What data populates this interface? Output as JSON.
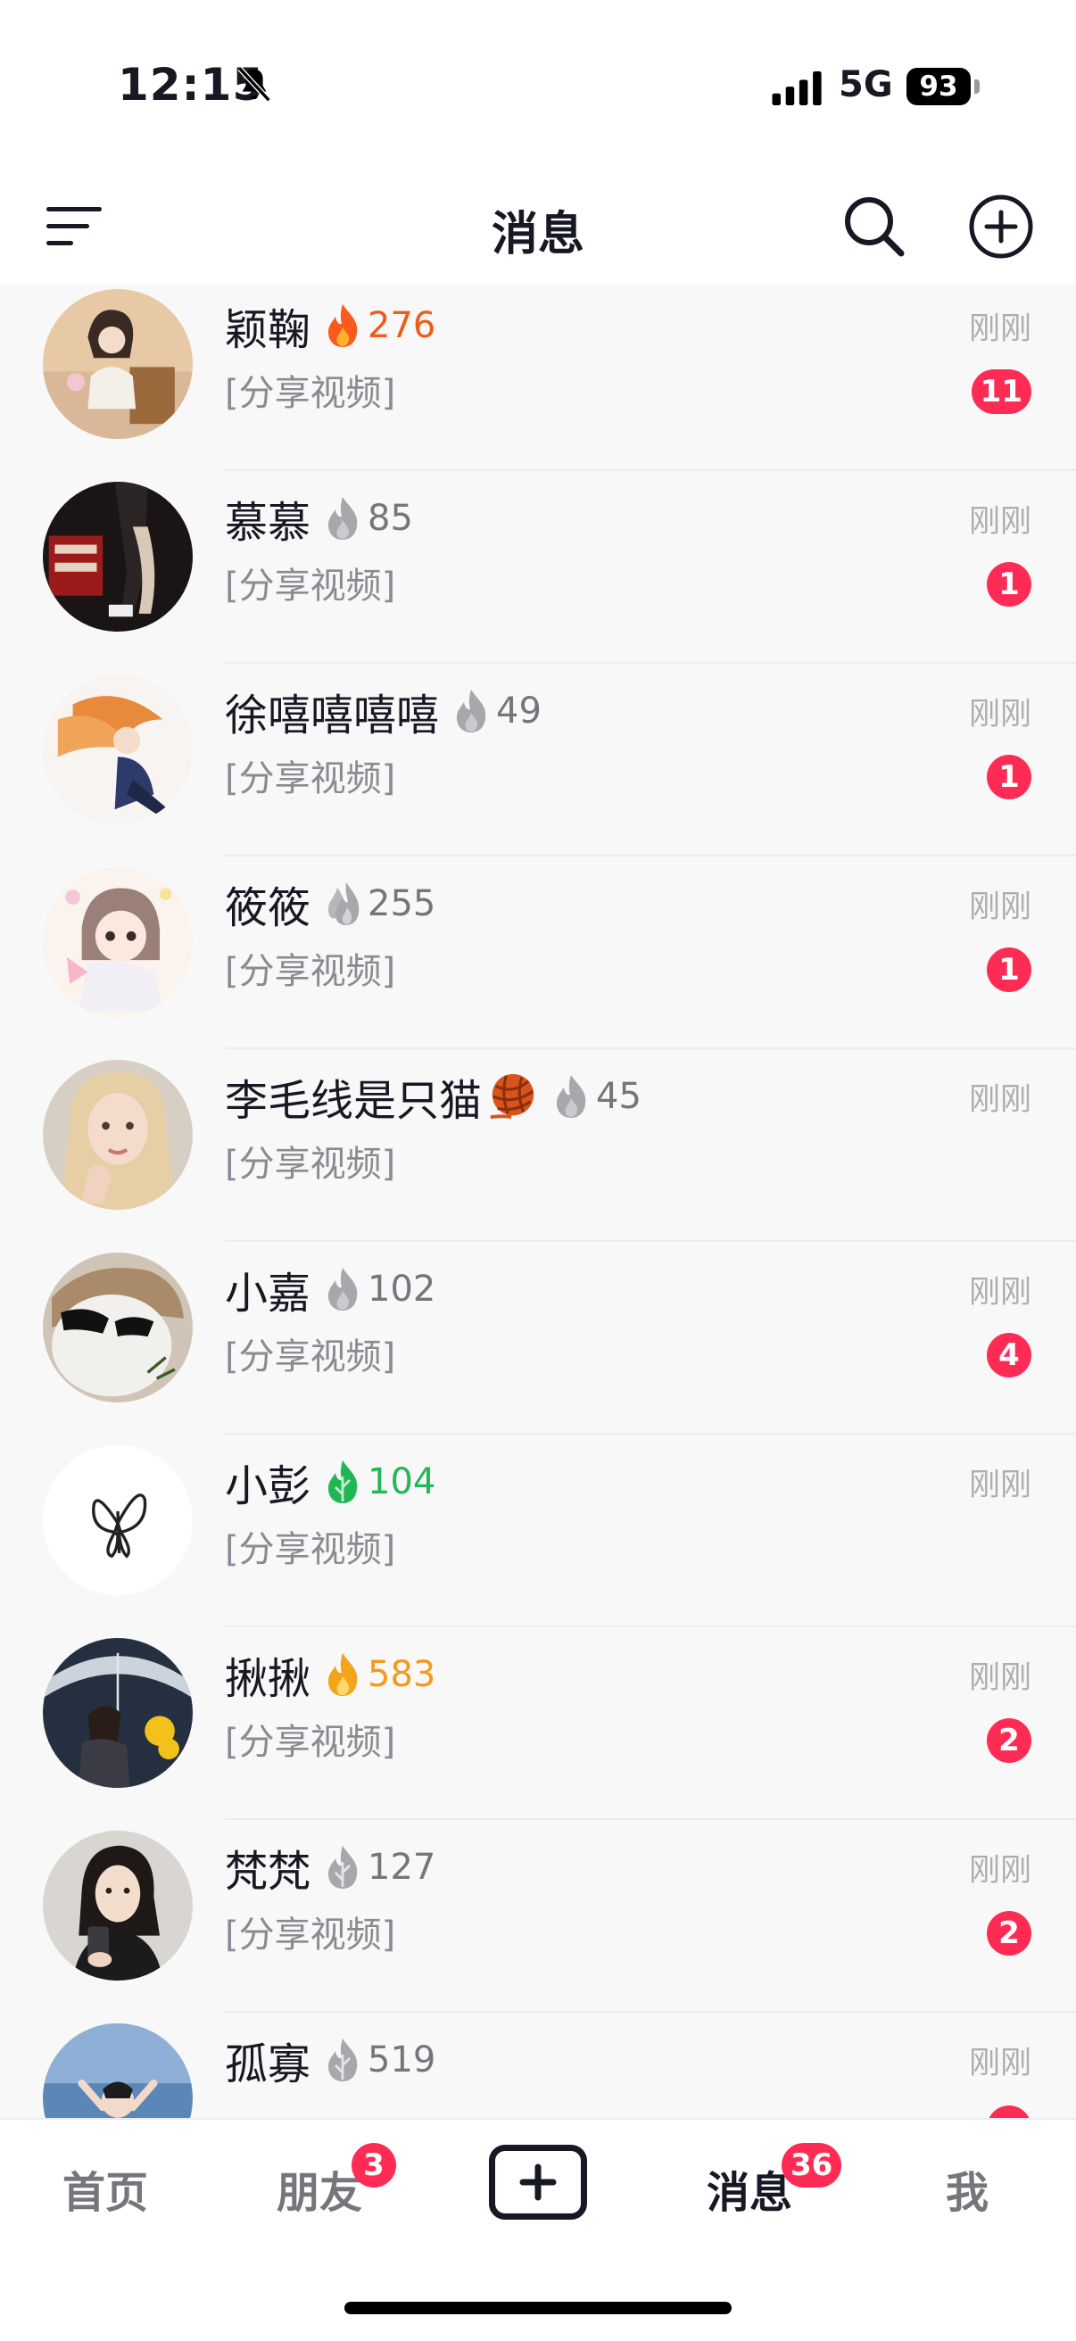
{
  "status_bar": {
    "time": "12:15",
    "network": "5G",
    "battery": "93"
  },
  "header": {
    "title": "消息"
  },
  "chats": [
    {
      "name": "颖鞠",
      "streak": "276",
      "streak_color": "#f05a1a",
      "flame": "orange-red",
      "preview": "[分享视频]",
      "time": "刚刚",
      "unread": "11"
    },
    {
      "name": "慕慕",
      "streak": "85",
      "streak_color": "#75767b",
      "flame": "grey",
      "preview": "[分享视频]",
      "time": "刚刚",
      "unread": "1"
    },
    {
      "name": "徐嘻嘻嘻嘻",
      "streak": "49",
      "streak_color": "#75767b",
      "flame": "grey",
      "preview": "[分享视频]",
      "time": "刚刚",
      "unread": "1"
    },
    {
      "name": "筱筱",
      "streak": "255",
      "streak_color": "#75767b",
      "flame": "grey-double",
      "preview": "[分享视频]",
      "time": "刚刚",
      "unread": "1"
    },
    {
      "name": "李毛线是只猫",
      "emoji": "yarn-ball",
      "streak": "45",
      "streak_color": "#75767b",
      "flame": "grey",
      "preview": "[分享视频]",
      "time": "刚刚",
      "unread": ""
    },
    {
      "name": "小嘉",
      "streak": "102",
      "streak_color": "#75767b",
      "flame": "grey",
      "preview": "[分享视频]",
      "time": "刚刚",
      "unread": "4"
    },
    {
      "name": "小彭",
      "streak": "104",
      "streak_color": "#22b857",
      "flame": "green",
      "preview": "[分享视频]",
      "time": "刚刚",
      "unread": ""
    },
    {
      "name": "揪揪",
      "streak": "583",
      "streak_color": "#f29a1a",
      "flame": "gold",
      "preview": "[分享视频]",
      "time": "刚刚",
      "unread": "2"
    },
    {
      "name": "梵梵",
      "streak": "127",
      "streak_color": "#75767b",
      "flame": "grey-leaf",
      "preview": "[分享视频]",
      "time": "刚刚",
      "unread": "2"
    },
    {
      "name": "孤寡",
      "streak": "519",
      "streak_color": "#75767b",
      "flame": "grey-leaf",
      "preview": "",
      "time": "刚刚",
      "unread": ""
    }
  ],
  "bottom_nav": {
    "home": "首页",
    "friends": "朋友",
    "friends_badge": "3",
    "messages": "消息",
    "messages_badge": "36",
    "me": "我"
  }
}
